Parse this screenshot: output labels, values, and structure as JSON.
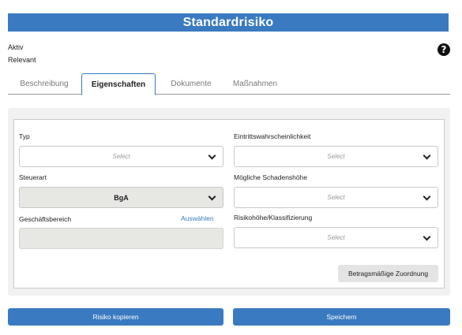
{
  "header": {
    "title": "Standardrisiko"
  },
  "status": {
    "line1": "Aktiv",
    "line2": "Relevant"
  },
  "help": {
    "glyph": "?"
  },
  "tabs": [
    {
      "label": "Beschreibung"
    },
    {
      "label": "Eigenschaften"
    },
    {
      "label": "Dokumente"
    },
    {
      "label": "Maßnahmen"
    }
  ],
  "form": {
    "typ": {
      "label": "Typ",
      "value": "Select"
    },
    "steuerart": {
      "label": "Steuerart",
      "value": "BgA"
    },
    "geschaeftsbereich": {
      "label": "Geschäftsbereich",
      "action": "Auswählen",
      "value": ""
    },
    "eintritt": {
      "label": "Eintrittswahrscheinlichkeit",
      "value": "Select"
    },
    "schaden": {
      "label": "Mögliche Schadenshöhe",
      "value": "Select"
    },
    "risikohoehe": {
      "label": "Risikohöhe/Klassifizierung",
      "value": "Select"
    },
    "zuordnung_button": "Betragsmäßige Zuordnung"
  },
  "actions": {
    "copy": "Risiko kopieren",
    "save": "Speichern"
  }
}
